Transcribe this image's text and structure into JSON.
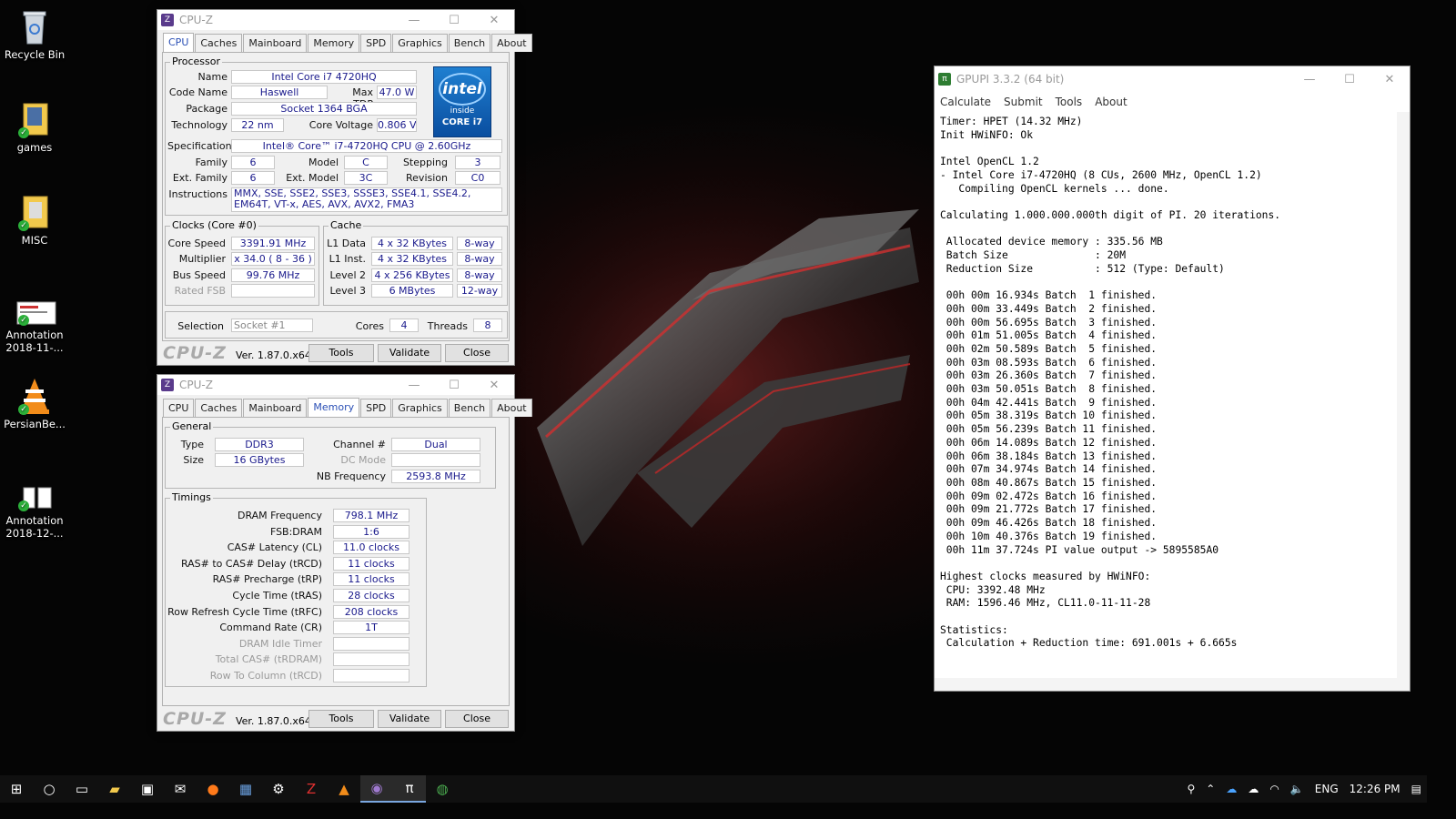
{
  "desktop": {
    "icons": [
      {
        "label": "Recycle Bin",
        "icon": "recycle-bin-icon"
      },
      {
        "label": "games",
        "icon": "folder-icon"
      },
      {
        "label": "MISC",
        "icon": "folder-icon"
      },
      {
        "label": "Annotation 2018-11-...",
        "icon": "image-file-icon"
      },
      {
        "label": "PersianBe...",
        "icon": "vlc-icon"
      },
      {
        "label": "Annotation 2018-12-...",
        "icon": "image-file-icon"
      }
    ]
  },
  "cpuz1": {
    "title": "CPU-Z",
    "tabs": [
      "CPU",
      "Caches",
      "Mainboard",
      "Memory",
      "SPD",
      "Graphics",
      "Bench",
      "About"
    ],
    "active_tab": "CPU",
    "processor": {
      "group": "Processor",
      "name_l": "Name",
      "name": "Intel Core i7 4720HQ",
      "code_l": "Code Name",
      "code": "Haswell",
      "tdp_l": "Max TDP",
      "tdp": "47.0 W",
      "package_l": "Package",
      "package": "Socket 1364 BGA",
      "tech_l": "Technology",
      "tech": "22 nm",
      "volt_l": "Core Voltage",
      "volt": "0.806 V",
      "spec_l": "Specification",
      "spec": "Intel® Core™ i7-4720HQ CPU @ 2.60GHz",
      "family_l": "Family",
      "family": "6",
      "model_l": "Model",
      "model": "C",
      "stepping_l": "Stepping",
      "stepping": "3",
      "extfam_l": "Ext. Family",
      "extfam": "6",
      "extmodel_l": "Ext. Model",
      "extmodel": "3C",
      "rev_l": "Revision",
      "rev": "C0",
      "instr_l": "Instructions",
      "instr": "MMX, SSE, SSE2, SSE3, SSSE3, SSE4.1, SSE4.2, EM64T, VT-x, AES, AVX, AVX2, FMA3"
    },
    "intel_logo": {
      "brand": "intel",
      "inside": "inside",
      "core": "CORE i7"
    },
    "clocks": {
      "group": "Clocks (Core #0)",
      "speed_l": "Core Speed",
      "speed": "3391.91 MHz",
      "mult_l": "Multiplier",
      "mult": "x 34.0 ( 8 - 36 )",
      "bus_l": "Bus Speed",
      "bus": "99.76 MHz",
      "fsb_l": "Rated FSB",
      "fsb": ""
    },
    "cache": {
      "group": "Cache",
      "l1d_l": "L1 Data",
      "l1d": "4 x 32 KBytes",
      "l1d_w": "8-way",
      "l1i_l": "L1 Inst.",
      "l1i": "4 x 32 KBytes",
      "l1i_w": "8-way",
      "l2_l": "Level 2",
      "l2": "4 x 256 KBytes",
      "l2_w": "8-way",
      "l3_l": "Level 3",
      "l3": "6 MBytes",
      "l3_w": "12-way"
    },
    "selection_l": "Selection",
    "selection": "Socket #1",
    "cores_l": "Cores",
    "cores": "4",
    "threads_l": "Threads",
    "threads": "8",
    "footer": {
      "logo": "CPU-Z",
      "version": "Ver. 1.87.0.x64",
      "tools": "Tools",
      "validate": "Validate",
      "close": "Close"
    }
  },
  "cpuz2": {
    "title": "CPU-Z",
    "tabs": [
      "CPU",
      "Caches",
      "Mainboard",
      "Memory",
      "SPD",
      "Graphics",
      "Bench",
      "About"
    ],
    "active_tab": "Memory",
    "general": {
      "group": "General",
      "type_l": "Type",
      "type": "DDR3",
      "size_l": "Size",
      "size": "16 GBytes",
      "channel_l": "Channel #",
      "channel": "Dual",
      "dc_l": "DC Mode",
      "dc": "",
      "nb_l": "NB Frequency",
      "nb": "2593.8 MHz"
    },
    "timings": {
      "group": "Timings",
      "rows": [
        {
          "label": "DRAM Frequency",
          "value": "798.1 MHz",
          "disabled": false
        },
        {
          "label": "FSB:DRAM",
          "value": "1:6",
          "disabled": false
        },
        {
          "label": "CAS# Latency (CL)",
          "value": "11.0 clocks",
          "disabled": false
        },
        {
          "label": "RAS# to CAS# Delay (tRCD)",
          "value": "11 clocks",
          "disabled": false
        },
        {
          "label": "RAS# Precharge (tRP)",
          "value": "11 clocks",
          "disabled": false
        },
        {
          "label": "Cycle Time (tRAS)",
          "value": "28 clocks",
          "disabled": false
        },
        {
          "label": "Row Refresh Cycle Time (tRFC)",
          "value": "208 clocks",
          "disabled": false
        },
        {
          "label": "Command Rate (CR)",
          "value": "1T",
          "disabled": false
        },
        {
          "label": "DRAM Idle Timer",
          "value": "",
          "disabled": true
        },
        {
          "label": "Total CAS# (tRDRAM)",
          "value": "",
          "disabled": true
        },
        {
          "label": "Row To Column (tRCD)",
          "value": "",
          "disabled": true
        }
      ]
    },
    "footer": {
      "logo": "CPU-Z",
      "version": "Ver. 1.87.0.x64",
      "tools": "Tools",
      "validate": "Validate",
      "close": "Close"
    }
  },
  "gpupi": {
    "title": "GPUPI 3.3.2 (64 bit)",
    "menu": [
      "Calculate",
      "Submit",
      "Tools",
      "About"
    ],
    "log": [
      "Timer: HPET (14.32 MHz)",
      "Init HWiNFO: Ok",
      "",
      "Intel OpenCL 1.2",
      "- Intel Core i7-4720HQ (8 CUs, 2600 MHz, OpenCL 1.2)",
      "   Compiling OpenCL kernels ... done.",
      "",
      "Calculating 1.000.000.000th digit of PI. 20 iterations.",
      "",
      " Allocated device memory : 335.56 MB",
      " Batch Size              : 20M",
      " Reduction Size          : 512 (Type: Default)",
      "",
      " 00h 00m 16.934s Batch  1 finished.",
      " 00h 00m 33.449s Batch  2 finished.",
      " 00h 00m 56.695s Batch  3 finished.",
      " 00h 01m 51.005s Batch  4 finished.",
      " 00h 02m 50.589s Batch  5 finished.",
      " 00h 03m 08.593s Batch  6 finished.",
      " 00h 03m 26.360s Batch  7 finished.",
      " 00h 03m 50.051s Batch  8 finished.",
      " 00h 04m 42.441s Batch  9 finished.",
      " 00h 05m 38.319s Batch 10 finished.",
      " 00h 05m 56.239s Batch 11 finished.",
      " 00h 06m 14.089s Batch 12 finished.",
      " 00h 06m 38.184s Batch 13 finished.",
      " 00h 07m 34.974s Batch 14 finished.",
      " 00h 08m 40.867s Batch 15 finished.",
      " 00h 09m 02.472s Batch 16 finished.",
      " 00h 09m 21.772s Batch 17 finished.",
      " 00h 09m 46.426s Batch 18 finished.",
      " 00h 10m 40.376s Batch 19 finished.",
      " 00h 11m 37.724s PI value output -> 5895585A0",
      "",
      "Highest clocks measured by HWiNFO:",
      " CPU: 3392.48 MHz",
      " RAM: 1596.46 MHz, CL11.0-11-11-28",
      "",
      "Statistics:",
      " Calculation + Reduction time: 691.001s + 6.665s"
    ]
  },
  "taskbar": {
    "apps": [
      "start-icon",
      "search-icon",
      "task-view-icon",
      "file-explorer-icon",
      "store-icon",
      "mail-icon",
      "firefox-icon",
      "hwinfo-icon",
      "tool-icon",
      "filezilla-icon",
      "vlc-icon",
      "cpuz-icon",
      "gpupi-icon",
      "chrome-icon"
    ],
    "tray": {
      "lang": "ENG",
      "time": "12:26 PM"
    }
  }
}
